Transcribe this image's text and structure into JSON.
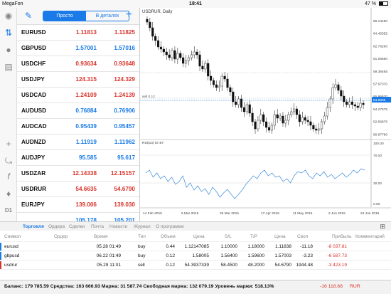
{
  "status": {
    "carrier": "MegaFon",
    "time": "18:41",
    "battery": "47 %",
    "battery_level": 0.47
  },
  "quotes": {
    "segment": [
      "Просто",
      "В деталях"
    ],
    "rows": [
      {
        "symbol": "EURUSD",
        "bid": "1.11813",
        "ask": "1.11825",
        "color": "red"
      },
      {
        "symbol": "GBPUSD",
        "bid": "1.57001",
        "ask": "1.57016",
        "color": "blue"
      },
      {
        "symbol": "USDCHF",
        "bid": "0.93634",
        "ask": "0.93648",
        "color": "red"
      },
      {
        "symbol": "USDJPY",
        "bid": "124.315",
        "ask": "124.329",
        "color": "red"
      },
      {
        "symbol": "USDCAD",
        "bid": "1.24109",
        "ask": "1.24139",
        "color": "red"
      },
      {
        "symbol": "AUDUSD",
        "bid": "0.76884",
        "ask": "0.76906",
        "color": "blue"
      },
      {
        "symbol": "AUDCAD",
        "bid": "0.95439",
        "ask": "0.95457",
        "color": "blue"
      },
      {
        "symbol": "AUDNZD",
        "bid": "1.11919",
        "ask": "1.11962",
        "color": "blue"
      },
      {
        "symbol": "AUDJPY",
        "bid": "95.585",
        "ask": "95.617",
        "color": "blue"
      },
      {
        "symbol": "USDZAR",
        "bid": "12.14338",
        "ask": "12.15157",
        "color": "red"
      },
      {
        "symbol": "USDRUR",
        "bid": "54.6635",
        "ask": "54.6790",
        "color": "red"
      },
      {
        "symbol": "EURJPY",
        "bid": "139.006",
        "ask": "139.030",
        "color": "red"
      },
      {
        "symbol": "",
        "bid": "105.178",
        "ask": "105.201",
        "color": "blue"
      }
    ]
  },
  "chart": {
    "title": "USDRUR, Daily",
    "price_ticks": [
      "66.14450",
      "64.45355",
      "62.76260",
      "61.05560",
      "59.36465",
      "57.67370",
      "55.96670",
      "54.27575",
      "52.56875",
      "50.87780"
    ],
    "current_price": "54.6635",
    "sell_label": "sell 0.12",
    "rsi_label": "RSI(14) 57.87",
    "rsi_ticks": [
      "100.00",
      "70.00",
      "30.00",
      "0.00"
    ],
    "date_ticks": [
      "14 Feb 2015",
      "5 Mar 2015",
      "26 Mar 2015",
      "17 Apr 2015",
      "11 May 2015",
      "2 Jun 2015",
      "24 Jun 2015"
    ]
  },
  "tabs": [
    "Торговля",
    "Ордера",
    "Сделки",
    "Почта",
    "Новости",
    "Журнал",
    "О программе"
  ],
  "table": {
    "headers": [
      "Символ",
      "Ордер",
      "Время",
      "Тип",
      "Объем",
      "Цена",
      "S/L",
      "T/P",
      "Цена",
      "Своп",
      "Прибыль",
      "Комментарий"
    ],
    "rows": [
      {
        "symbol": "eurusd",
        "time": "05.28 01:49",
        "type": "buy",
        "volume": "0.44",
        "price": "1.12147085",
        "sl": "1.10000",
        "tp": "1.18000",
        "current": "1.11838",
        "swap": "-11.18",
        "profit": "-8 037.81"
      },
      {
        "symbol": "gbpusd",
        "time": "06.22 01:49",
        "type": "buy",
        "volume": "0.12",
        "price": "1.58005",
        "sl": "1.56400",
        "tp": "1.59600",
        "current": "1.57003",
        "swap": "-3.23",
        "profit": "-6 587.73"
      },
      {
        "symbol": "usdrur",
        "time": "05.29 11:01",
        "type": "sell",
        "volume": "0.12",
        "price": "54.3937339",
        "sl": "58.4500",
        "tp": "48.2000",
        "current": "54.6790",
        "swap": "1944.48",
        "profit": "-3 423.19"
      }
    ]
  },
  "balance": {
    "text": "Баланс: 179 785.59 Средства: 163 666.93 Маржа: 31 587.74 Свободная маржа: 132 079.19 Уровень маржи: 518.13%",
    "profit": "-16 118.66",
    "currency": "RUR"
  }
}
